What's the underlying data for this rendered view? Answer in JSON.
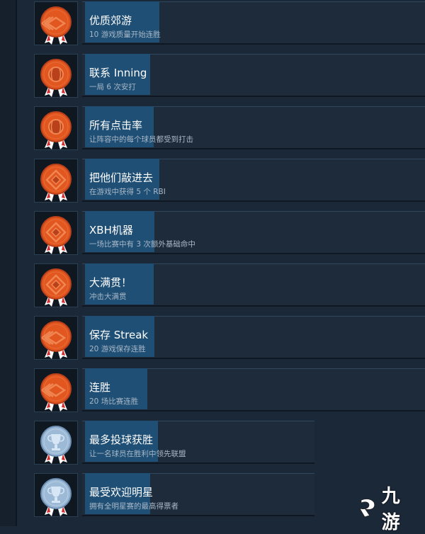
{
  "achievements": [
    {
      "title": "优质郊游",
      "desc": "10 游戏质量开始连胜",
      "badge": "orange-chevron-medal-icon",
      "tier": "bronze"
    },
    {
      "title": "联系 Inning",
      "desc": "一局 6 次安打",
      "badge": "orange-baseball-medal-icon",
      "tier": "bronze"
    },
    {
      "title": "所有点击率",
      "desc": "让阵容中的每个球员都受到打击",
      "badge": "orange-baseball-medal-icon",
      "tier": "bronze"
    },
    {
      "title": "把他们敲进去",
      "desc": "在游戏中获得 5 个 RBI",
      "badge": "orange-diamond-medal-icon",
      "tier": "bronze"
    },
    {
      "title": "XBH机器",
      "desc": "一场比赛中有 3 次额外基础命中",
      "badge": "orange-diamond-medal-icon",
      "tier": "bronze"
    },
    {
      "title": "大满贯！",
      "desc": "冲击大满贯",
      "badge": "orange-diamond-medal-icon",
      "tier": "bronze"
    },
    {
      "title": "保存 Streak",
      "desc": "20 游戏保存连胜",
      "badge": "orange-chevron-medal-icon",
      "tier": "bronze"
    },
    {
      "title": "连胜",
      "desc": "20 场比赛连胜",
      "badge": "orange-chevron-medal-icon",
      "tier": "bronze"
    },
    {
      "title": "最多投球获胜",
      "desc": "让一名球员在胜利中领先联盟",
      "badge": "silver-trophy-medal-icon",
      "tier": "silver"
    },
    {
      "title": "最受欢迎明星",
      "desc": "拥有全明星赛的最高得票者",
      "badge": "silver-trophy-medal-icon",
      "tier": "silver"
    }
  ],
  "watermark": {
    "text": "九游",
    "icon": "jiuyou-logo-icon"
  },
  "colors": {
    "background": "#1b2838",
    "card": "#1d2b3a",
    "highlight": "#1f4f75",
    "bronze": "#e0531f",
    "silver": "#9ab8d6"
  }
}
